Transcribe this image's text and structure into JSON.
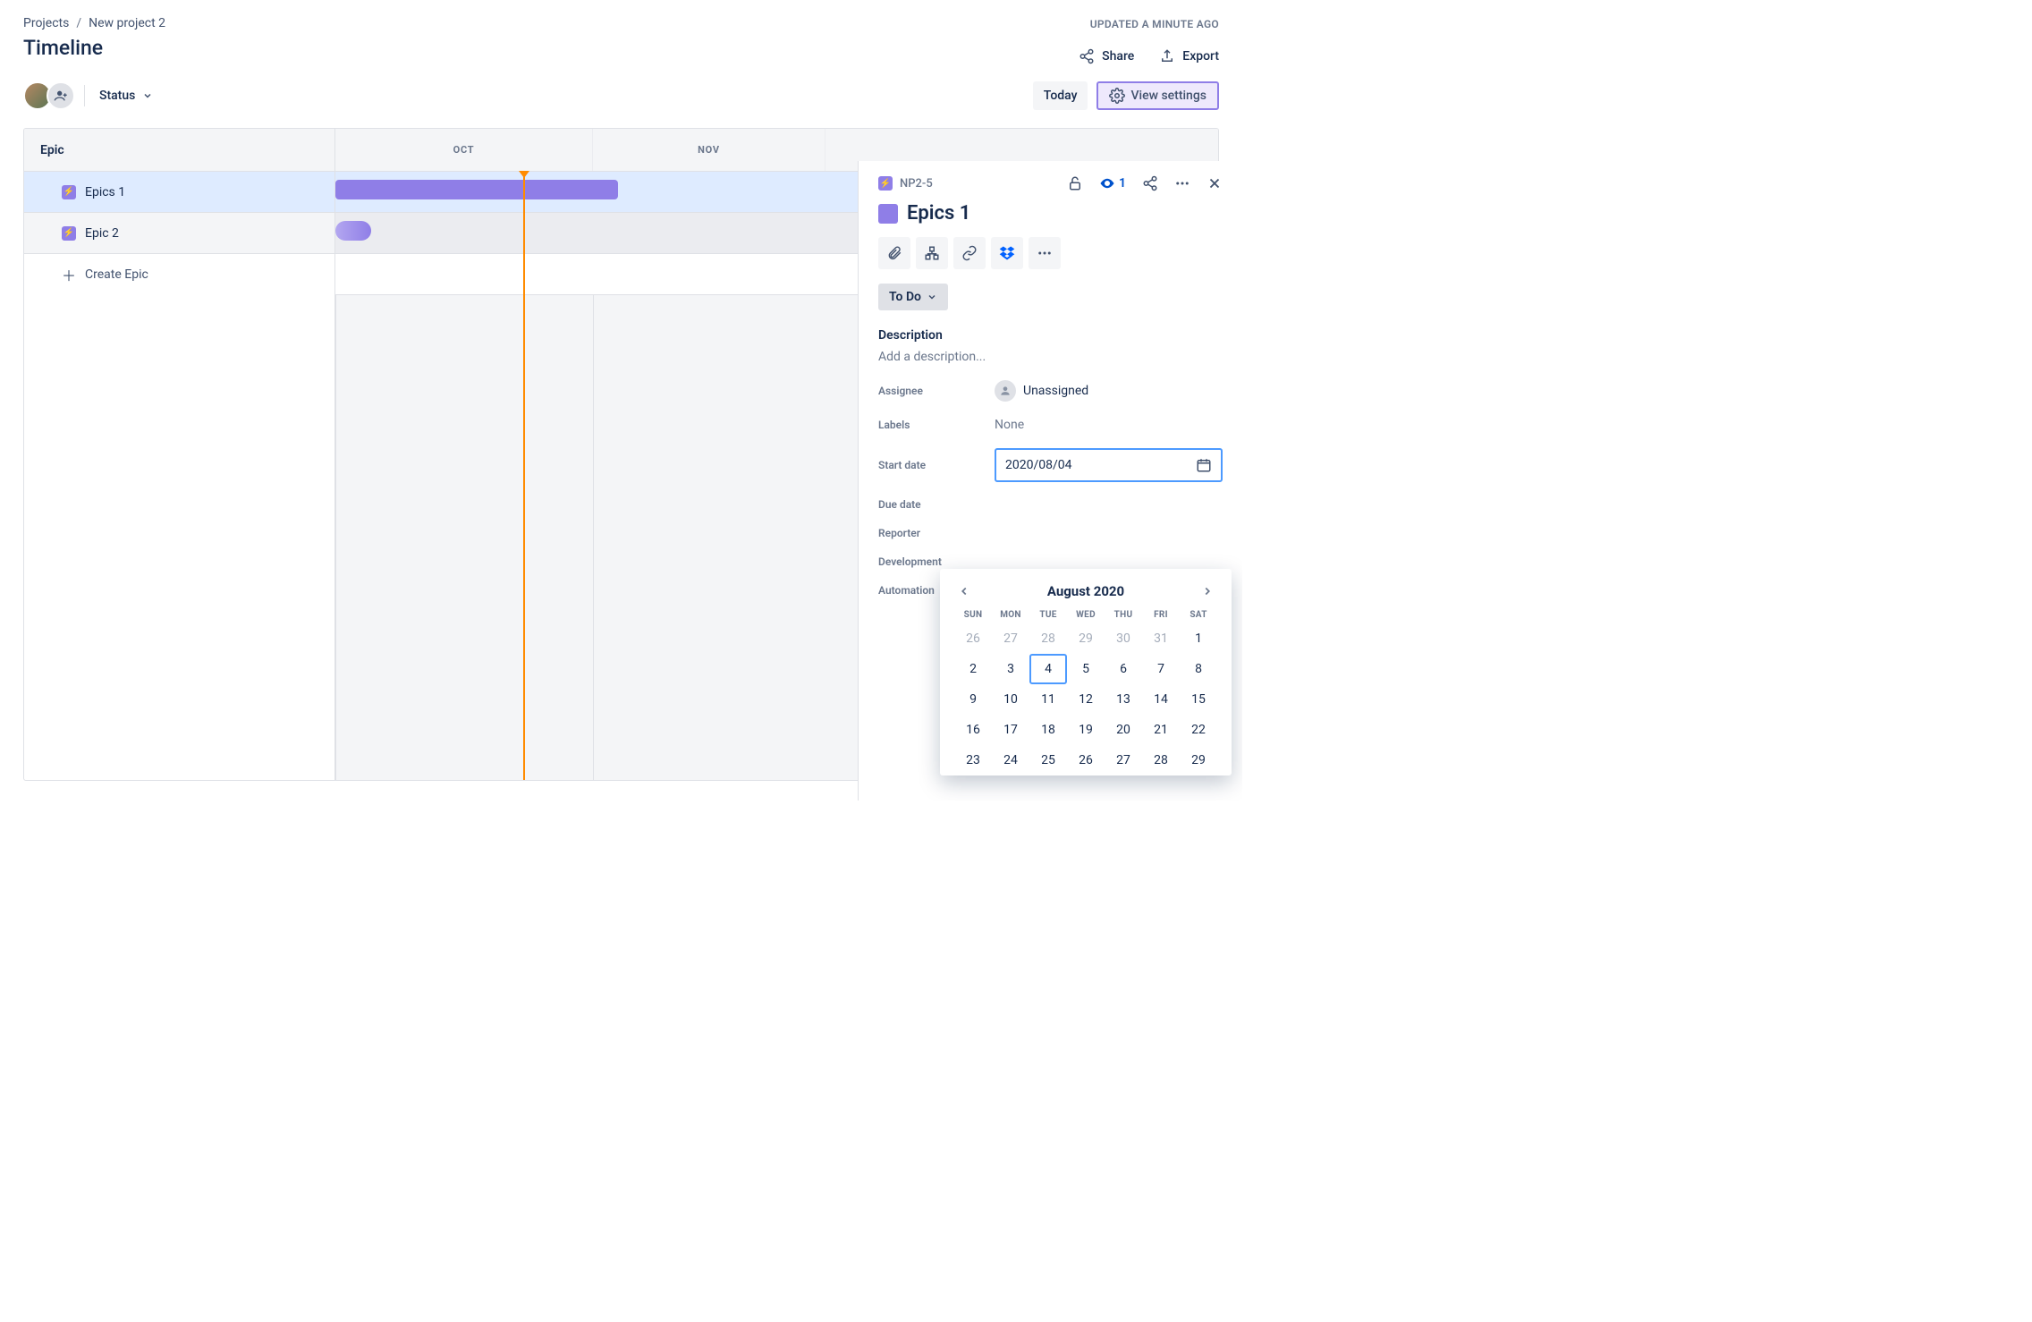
{
  "breadcrumb": {
    "projects": "Projects",
    "project": "New project 2"
  },
  "updated": "UPDATED A MINUTE AGO",
  "page_title": "Timeline",
  "header_actions": {
    "share": "Share",
    "export": "Export"
  },
  "toolbar": {
    "status": "Status",
    "today": "Today",
    "view_settings": "View settings"
  },
  "timeline": {
    "side_header": "Epic",
    "months": [
      "OCT",
      "NOV"
    ],
    "epics": [
      {
        "name": "Epics 1",
        "selected": true
      },
      {
        "name": "Epic 2",
        "selected": false
      }
    ],
    "create": "Create Epic"
  },
  "panel": {
    "key": "NP2-5",
    "watch_count": "1",
    "title": "Epics 1",
    "status": "To Do",
    "description_label": "Description",
    "description_placeholder": "Add a description...",
    "fields": {
      "assignee_label": "Assignee",
      "assignee_value": "Unassigned",
      "labels_label": "Labels",
      "labels_value": "None",
      "start_date_label": "Start date",
      "start_date_value": "2020/08/04",
      "due_date_label": "Due date",
      "reporter_label": "Reporter",
      "development_label": "Development",
      "automation_label": "Automation"
    }
  },
  "calendar": {
    "title": "August 2020",
    "dow": [
      "SUN",
      "MON",
      "TUE",
      "WED",
      "THU",
      "FRI",
      "SAT"
    ],
    "days": [
      {
        "n": "26",
        "other": true
      },
      {
        "n": "27",
        "other": true
      },
      {
        "n": "28",
        "other": true
      },
      {
        "n": "29",
        "other": true
      },
      {
        "n": "30",
        "other": true
      },
      {
        "n": "31",
        "other": true
      },
      {
        "n": "1"
      },
      {
        "n": "2"
      },
      {
        "n": "3"
      },
      {
        "n": "4",
        "sel": true
      },
      {
        "n": "5"
      },
      {
        "n": "6"
      },
      {
        "n": "7"
      },
      {
        "n": "8"
      },
      {
        "n": "9"
      },
      {
        "n": "10"
      },
      {
        "n": "11"
      },
      {
        "n": "12"
      },
      {
        "n": "13"
      },
      {
        "n": "14"
      },
      {
        "n": "15"
      },
      {
        "n": "16"
      },
      {
        "n": "17"
      },
      {
        "n": "18"
      },
      {
        "n": "19"
      },
      {
        "n": "20"
      },
      {
        "n": "21"
      },
      {
        "n": "22"
      },
      {
        "n": "23"
      },
      {
        "n": "24"
      },
      {
        "n": "25"
      },
      {
        "n": "26"
      },
      {
        "n": "27"
      },
      {
        "n": "28"
      },
      {
        "n": "29"
      }
    ]
  }
}
